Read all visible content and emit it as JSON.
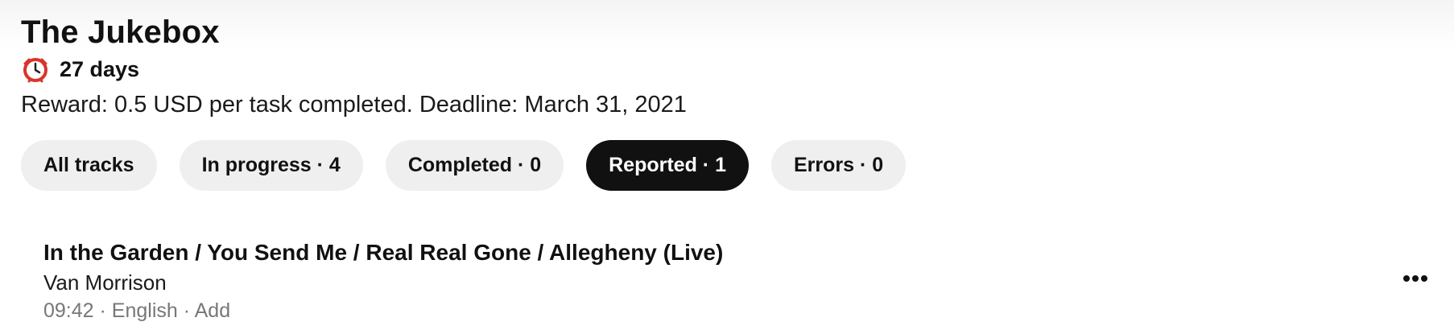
{
  "page": {
    "title": "The Jukebox",
    "time_left": "27 days",
    "reward_text": "Reward: 0.5 USD per task completed. Deadline: March 31, 2021"
  },
  "icons": {
    "timer": "alarm-clock-icon",
    "more": "more-horizontal-icon"
  },
  "colors": {
    "active_chip_bg": "#111111",
    "chip_bg": "#efefef",
    "meta_text": "#777777",
    "alarm_red": "#d9342b"
  },
  "filters": [
    {
      "label": "All tracks",
      "active": false
    },
    {
      "label": "In progress · 4",
      "active": false
    },
    {
      "label": "Completed · 0",
      "active": false
    },
    {
      "label": "Reported · 1",
      "active": true
    },
    {
      "label": "Errors · 0",
      "active": false
    }
  ],
  "tracks": [
    {
      "title": "In the Garden / You Send Me / Real Real Gone / Allegheny (Live)",
      "artist": "Van Morrison",
      "meta": "09:42 · English · Add"
    }
  ]
}
